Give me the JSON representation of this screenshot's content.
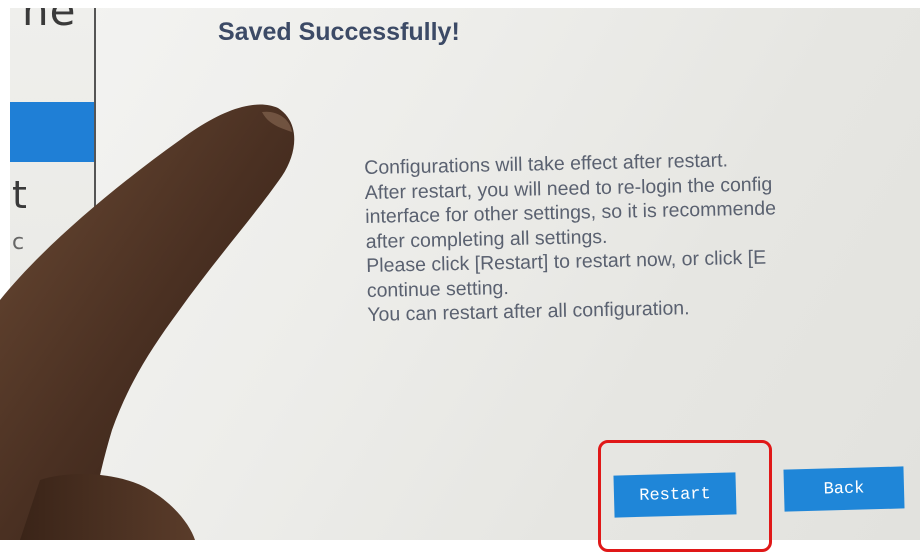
{
  "sidebar": {
    "top_fragment": "ne",
    "item_fragment": "t",
    "lower_fragment": "c"
  },
  "dialog": {
    "title": "Saved Successfully!",
    "message_lines": [
      "Configurations will take effect after restart.",
      "After restart, you will need to re-login the config",
      "interface for other settings, so it is recommende",
      "after completing all settings.",
      "Please click [Restart] to restart now, or click [E",
      "continue setting.",
      "You can restart after all configuration."
    ],
    "restart_label": "Restart",
    "back_label": "Back"
  },
  "colors": {
    "accent": "#1f86d8",
    "highlight": "#e01818",
    "title": "#3c4a66"
  }
}
